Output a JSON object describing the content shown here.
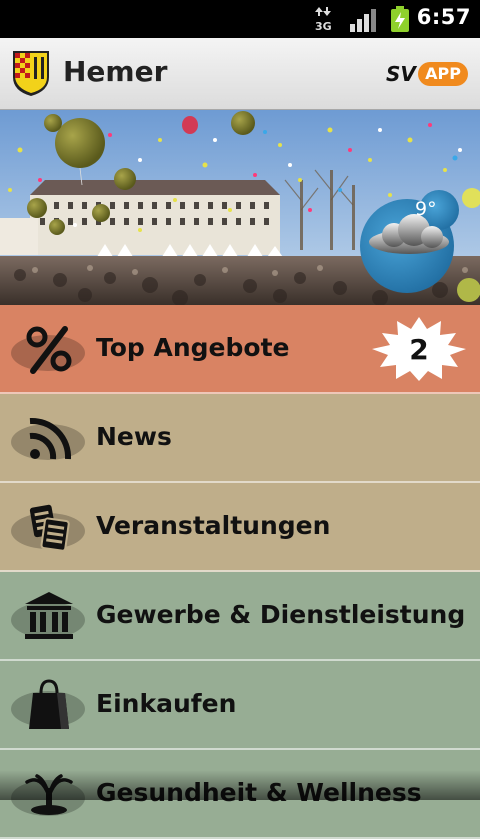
{
  "status_bar": {
    "network": "3G",
    "time": "6:57",
    "icons": [
      "data-arrows-icon",
      "signal-icon",
      "battery-charging-icon"
    ]
  },
  "app_bar": {
    "title": "Hemer",
    "logo_prefix": "SV",
    "logo_pill": "APP",
    "colors": {
      "pill": "#f08a1e"
    }
  },
  "hero": {
    "weather": {
      "temperature": "9°",
      "icon": "cloud-icon"
    }
  },
  "menu": {
    "items": [
      {
        "label": "Top Angebote",
        "icon": "percent-icon",
        "badge": "2",
        "color": "#d98363"
      },
      {
        "label": "News",
        "icon": "rss-icon",
        "color": "#bfae8a"
      },
      {
        "label": "Veranstaltungen",
        "icon": "calendar-icon",
        "color": "#bfae8a"
      },
      {
        "label": "Gewerbe & Dienstleistung",
        "icon": "building-icon",
        "color": "#97ad94"
      },
      {
        "label": "Einkaufen",
        "icon": "shopping-bag-icon",
        "color": "#97ad94"
      },
      {
        "label": "Gesundheit & Wellness",
        "icon": "fountain-icon",
        "color": "#97ad94"
      }
    ]
  }
}
